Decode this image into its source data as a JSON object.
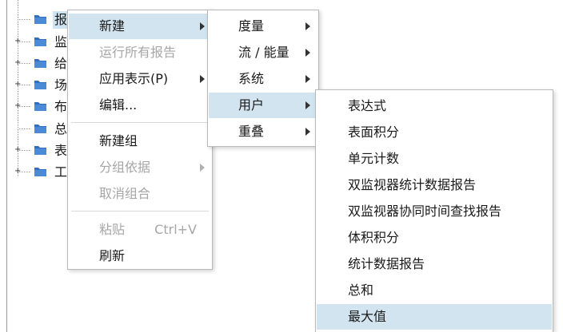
{
  "tree": {
    "items": [
      {
        "label": "报",
        "expander": ""
      },
      {
        "label": "监",
        "expander": "+"
      },
      {
        "label": "给",
        "expander": "+"
      },
      {
        "label": "场",
        "expander": "+"
      },
      {
        "label": "布",
        "expander": "+"
      },
      {
        "label": "总",
        "expander": ""
      },
      {
        "label": "表",
        "expander": "+"
      },
      {
        "label": "工",
        "expander": "+"
      }
    ]
  },
  "context_menu": {
    "new": "新建",
    "run_all_reports": "运行所有报告",
    "apply_representation": "应用表示(P)",
    "edit": "编辑...",
    "new_group": "新建组",
    "group_by": "分组依据",
    "ungroup": "取消组合",
    "paste": "粘贴",
    "paste_shortcut": "Ctrl+V",
    "refresh": "刷新"
  },
  "new_submenu": {
    "metric": "度量",
    "flow_energy": "流 / 能量",
    "system": "系统",
    "user": "用户",
    "overlay": "重叠"
  },
  "user_submenu": {
    "expression": "表达式",
    "surface_integral": "表面积分",
    "cell_count": "单元计数",
    "dual_monitor_stats": "双监视器统计数据报告",
    "dual_monitor_time_lookup": "双监视器协同时间查找报告",
    "volume_integral": "体积积分",
    "statistics_report": "统计数据报告",
    "sum": "总和",
    "maximum": "最大值"
  },
  "colors": {
    "highlight": "#d2e4ef",
    "folder": "#2f6fbf",
    "disabled_text": "#a6a6a6"
  }
}
